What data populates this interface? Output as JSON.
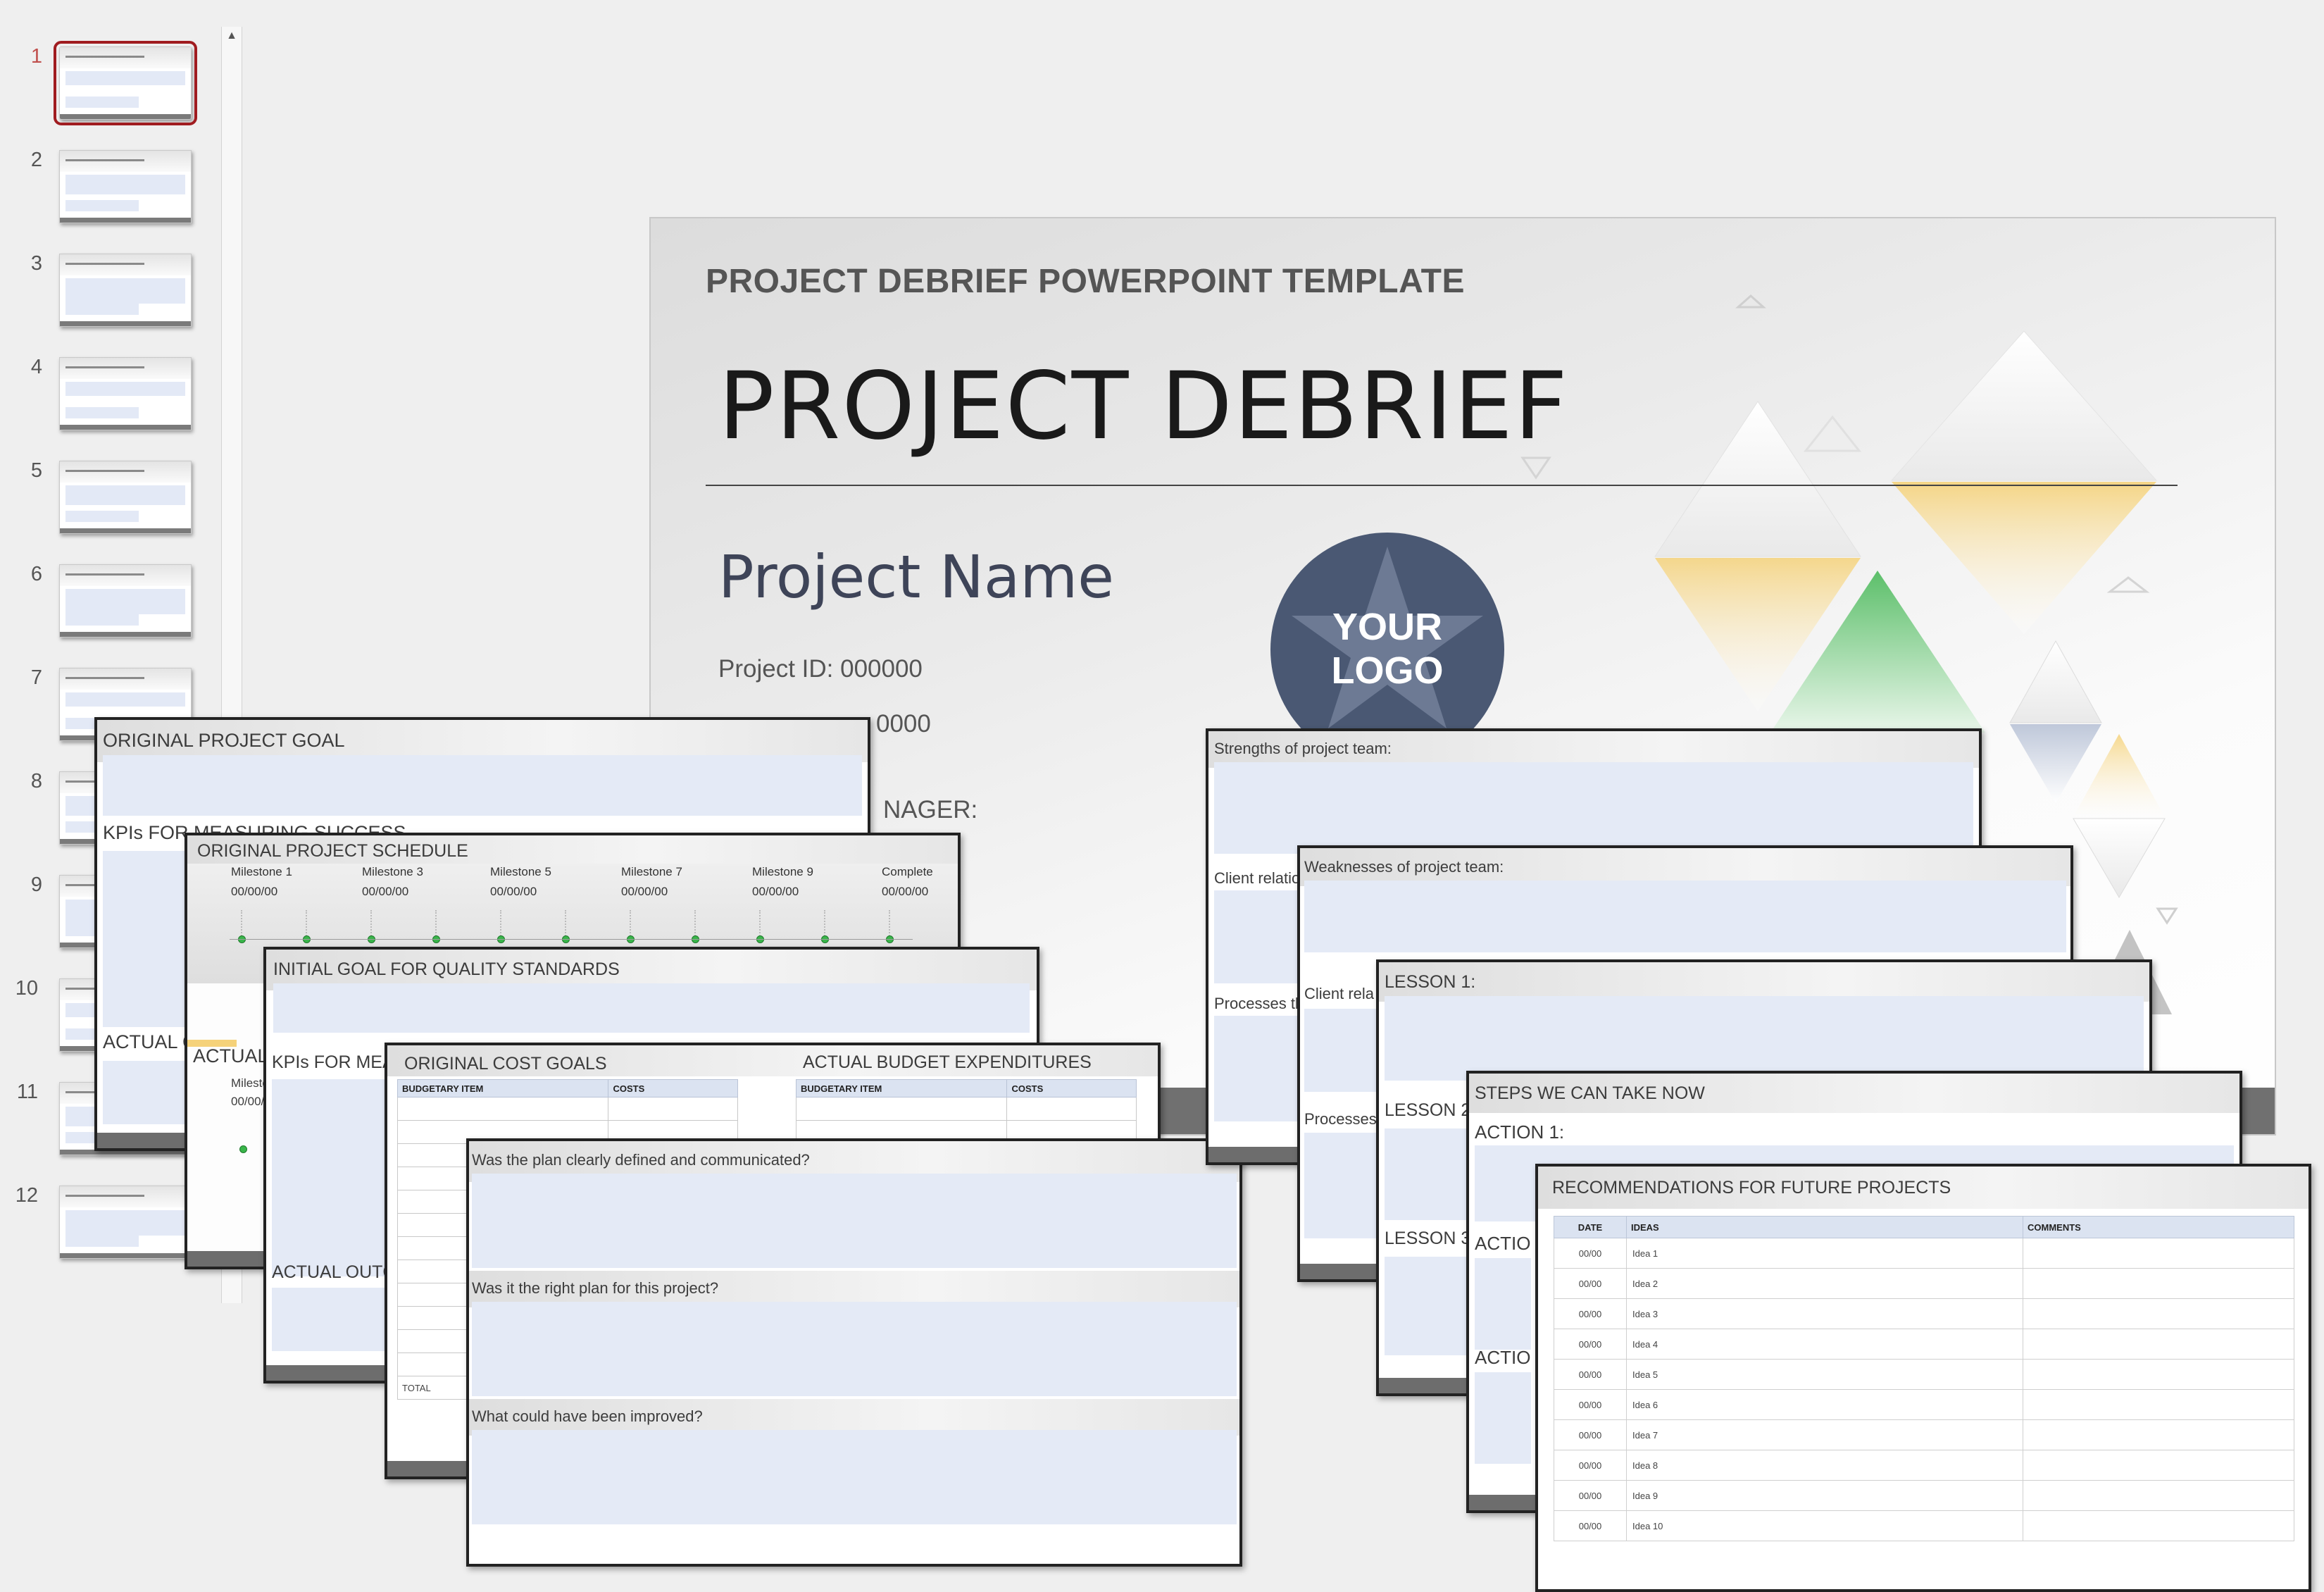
{
  "thumbnails": [
    {
      "number": "1",
      "active": true
    },
    {
      "number": "2",
      "active": false
    },
    {
      "number": "3",
      "active": false
    },
    {
      "number": "4",
      "active": false
    },
    {
      "number": "5",
      "active": false
    },
    {
      "number": "6",
      "active": false
    },
    {
      "number": "7",
      "active": false
    },
    {
      "number": "8",
      "active": false
    },
    {
      "number": "9",
      "active": false
    },
    {
      "number": "10",
      "active": false
    },
    {
      "number": "11",
      "active": false
    },
    {
      "number": "12",
      "active": false
    }
  ],
  "main_slide": {
    "header": "PROJECT DEBRIEF POWERPOINT TEMPLATE",
    "title": "PROJECT DEBRIEF",
    "project_name": "Project Name",
    "project_id": "Project ID:  000000",
    "field_two_value": "0000",
    "manager_fragment": "NAGER:",
    "logo_line1": "YOUR",
    "logo_line2": "LOGO"
  },
  "slide_goal": {
    "title": "ORIGINAL PROJECT GOAL",
    "kpi_label": "KPIs FOR MEASURING SUCCESS",
    "actual_label": "ACTUAL C"
  },
  "slide_schedule": {
    "title": "ORIGINAL PROJECT SCHEDULE",
    "milestones": [
      {
        "label": "Milestone 1",
        "date": "00/00/00"
      },
      {
        "label": "Milestone 3",
        "date": "00/00/00"
      },
      {
        "label": "Milestone 5",
        "date": "00/00/00"
      },
      {
        "label": "Milestone 7",
        "date": "00/00/00"
      },
      {
        "label": "Milestone 9",
        "date": "00/00/00"
      },
      {
        "label": "Complete",
        "date": "00/00/00"
      }
    ],
    "actual_label": "ACTUAL",
    "actual_fragment": "Milesto",
    "actual_date_fragment": "00/00/"
  },
  "slide_quality": {
    "title": "INITIAL GOAL FOR QUALITY STANDARDS",
    "kpi_label": "KPIs FOR MEA",
    "actual_label": "ACTUAL OUTC"
  },
  "slide_cost": {
    "title_left": "ORIGINAL COST GOALS",
    "title_right": "ACTUAL BUDGET EXPENDITURES",
    "col_item": "BUDGETARY ITEM",
    "col_costs": "COSTS",
    "total_label": "TOTAL"
  },
  "slide_questions": {
    "q1": "Was the plan clearly defined and communicated?",
    "q2": "Was it the right plan for this project?",
    "q3": "What could have been improved?"
  },
  "slide_strengths": {
    "title": "Strengths of project team:",
    "client_fragment": "Client relatio",
    "process_fragment": "Processes th"
  },
  "slide_weaknesses": {
    "title": "Weaknesses of project team:",
    "client_fragment": "Client rela",
    "process_fragment": "Processes"
  },
  "slide_lessons": {
    "lesson1": "LESSON 1:",
    "lesson2": "LESSON 2",
    "lesson3": "LESSON 3"
  },
  "slide_steps": {
    "title": "STEPS WE CAN TAKE NOW",
    "action1": "ACTION 1:",
    "action2_fragment": "ACTIO",
    "action3_fragment": "ACTIO"
  },
  "slide_recommendations": {
    "title": "RECOMMENDATIONS FOR FUTURE PROJECTS",
    "columns": [
      "DATE",
      "IDEAS",
      "COMMENTS"
    ],
    "rows": [
      {
        "date": "00/00",
        "idea": "Idea 1"
      },
      {
        "date": "00/00",
        "idea": "Idea 2"
      },
      {
        "date": "00/00",
        "idea": "Idea 3"
      },
      {
        "date": "00/00",
        "idea": "Idea 4"
      },
      {
        "date": "00/00",
        "idea": "Idea 5"
      },
      {
        "date": "00/00",
        "idea": "Idea 6"
      },
      {
        "date": "00/00",
        "idea": "Idea 7"
      },
      {
        "date": "00/00",
        "idea": "Idea 8"
      },
      {
        "date": "00/00",
        "idea": "Idea 9"
      },
      {
        "date": "00/00",
        "idea": "Idea 10"
      }
    ]
  },
  "colors": {
    "active_thumb_border": "#a01c20",
    "logo_circle": "#4a5873",
    "milestone_dot": "#39b54a",
    "panel_blue": "#e4eaf6"
  }
}
